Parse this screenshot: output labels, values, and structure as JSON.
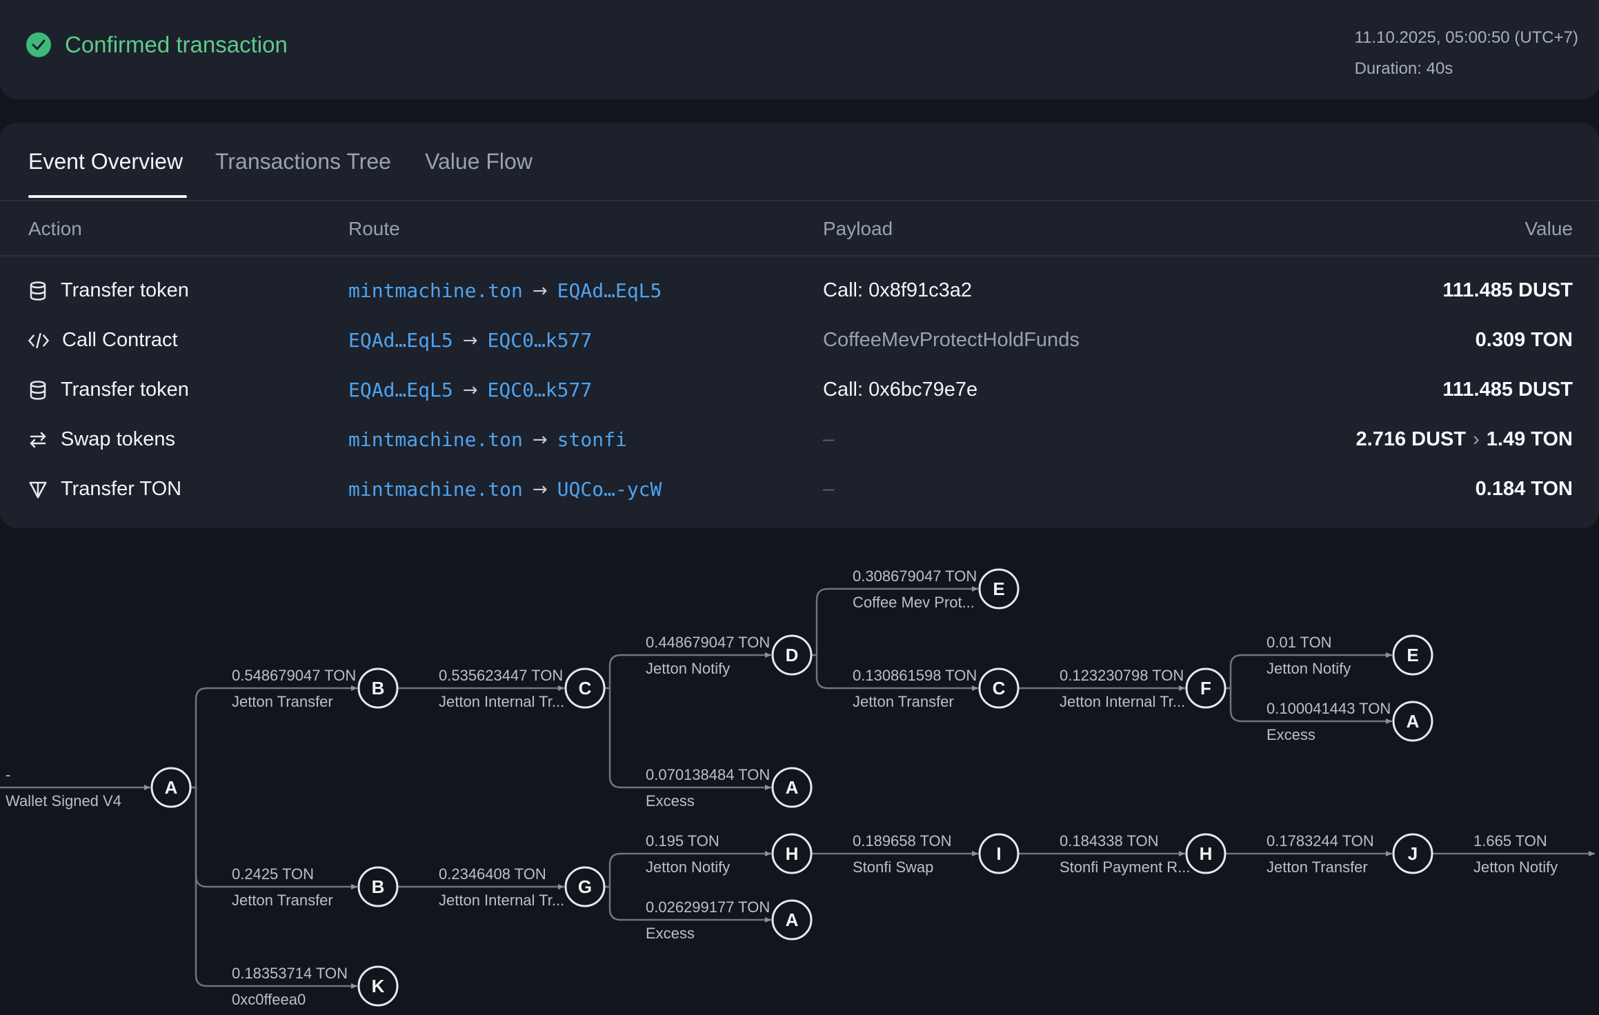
{
  "header": {
    "status": "Confirmed transaction",
    "datetime": "11.10.2025, 05:00:50 (UTC+7)",
    "duration": "Duration: 40s"
  },
  "tabs": [
    "Event Overview",
    "Transactions Tree",
    "Value Flow"
  ],
  "table": {
    "headers": {
      "action": "Action",
      "route": "Route",
      "payload": "Payload",
      "value": "Value"
    },
    "rows": [
      {
        "icon": "database-icon",
        "action": "Transfer token",
        "from": "mintmachine.ton",
        "to": "EQAd…EqL5",
        "payload": "Call: 0x8f91c3a2",
        "value": "111.485 DUST"
      },
      {
        "icon": "code-icon",
        "action": "Call Contract",
        "from": "EQAd…EqL5",
        "to": "EQC0…k577",
        "payload": "CoffeeMevProtectHoldFunds",
        "value": "0.309 TON"
      },
      {
        "icon": "database-icon",
        "action": "Transfer token",
        "from": "EQAd…EqL5",
        "to": "EQC0…k577",
        "payload": "Call: 0x6bc79e7e",
        "value": "111.485 DUST"
      },
      {
        "icon": "swap-icon",
        "action": "Swap tokens",
        "from": "mintmachine.ton",
        "to": "stonfi",
        "payload": "–",
        "value_from": "2.716 DUST",
        "value_to": "1.49 TON"
      },
      {
        "icon": "ton-icon",
        "action": "Transfer TON",
        "from": "mintmachine.ton",
        "to": "UQCo…-ycW",
        "payload": "–",
        "value": "0.184 TON"
      }
    ]
  },
  "tree": {
    "root_edge": {
      "amount": "-",
      "label": "Wallet Signed V4"
    },
    "nodes": [
      {
        "id": "n-A-root",
        "letter": "A"
      },
      {
        "id": "n-B1",
        "letter": "B"
      },
      {
        "id": "n-C1",
        "letter": "C"
      },
      {
        "id": "n-D",
        "letter": "D"
      },
      {
        "id": "n-E1",
        "letter": "E"
      },
      {
        "id": "n-C2",
        "letter": "C"
      },
      {
        "id": "n-F",
        "letter": "F"
      },
      {
        "id": "n-E2",
        "letter": "E"
      },
      {
        "id": "n-A2",
        "letter": "A"
      },
      {
        "id": "n-A3",
        "letter": "A"
      },
      {
        "id": "n-B2",
        "letter": "B"
      },
      {
        "id": "n-G",
        "letter": "G"
      },
      {
        "id": "n-H1",
        "letter": "H"
      },
      {
        "id": "n-A4",
        "letter": "A"
      },
      {
        "id": "n-I",
        "letter": "I"
      },
      {
        "id": "n-H2",
        "letter": "H"
      },
      {
        "id": "n-J",
        "letter": "J"
      },
      {
        "id": "n-K",
        "letter": "K"
      }
    ],
    "edges": [
      {
        "amount": "0.548679047 TON",
        "label": "Jetton Transfer"
      },
      {
        "amount": "0.535623447 TON",
        "label": "Jetton Internal Tr..."
      },
      {
        "amount": "0.448679047 TON",
        "label": "Jetton Notify"
      },
      {
        "amount": "0.308679047 TON",
        "label": "Coffee Mev Prot..."
      },
      {
        "amount": "0.130861598 TON",
        "label": "Jetton Transfer"
      },
      {
        "amount": "0.123230798 TON",
        "label": "Jetton Internal Tr..."
      },
      {
        "amount": "0.01 TON",
        "label": "Jetton Notify"
      },
      {
        "amount": "0.100041443 TON",
        "label": "Excess"
      },
      {
        "amount": "0.070138484 TON",
        "label": "Excess"
      },
      {
        "amount": "0.2425 TON",
        "label": "Jetton Transfer"
      },
      {
        "amount": "0.2346408 TON",
        "label": "Jetton Internal Tr..."
      },
      {
        "amount": "0.195 TON",
        "label": "Jetton Notify"
      },
      {
        "amount": "0.026299177 TON",
        "label": "Excess"
      },
      {
        "amount": "0.189658 TON",
        "label": "Stonfi Swap"
      },
      {
        "amount": "0.184338 TON",
        "label": "Stonfi Payment R..."
      },
      {
        "amount": "0.1783244 TON",
        "label": "Jetton Transfer"
      },
      {
        "amount": "1.665 TON",
        "label": "Jetton Notify"
      },
      {
        "amount": "0.18353714 TON",
        "label": "0xc0ffeea0"
      }
    ]
  }
}
